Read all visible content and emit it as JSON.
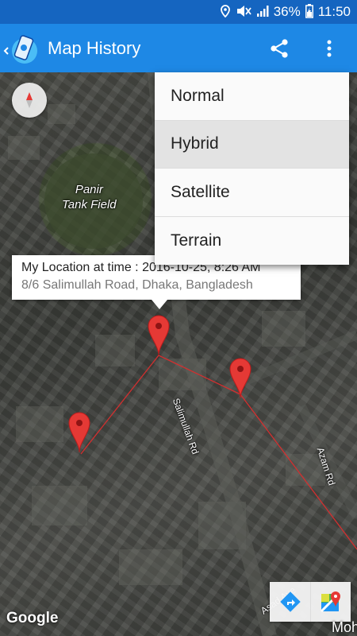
{
  "status_bar": {
    "battery": "36%",
    "time": "11:50"
  },
  "app_bar": {
    "title": "Map History"
  },
  "map": {
    "place_label": "Panir\nTank Field",
    "roads": [
      {
        "label": "Salimullah Rd"
      },
      {
        "label": "Azam Rd"
      },
      {
        "label": "Asad Ave"
      }
    ],
    "corner_text": "Moh",
    "google_logo": "Google",
    "info_window": {
      "title": "My Location at time : 2016-10-25,  8:26 AM",
      "address": "8/6 Salimullah Road, Dhaka, Bangladesh"
    },
    "path_color": "#d32f2f",
    "pin_color": "#e53935"
  },
  "menu": {
    "items": [
      {
        "label": "Normal"
      },
      {
        "label": "Hybrid"
      },
      {
        "label": "Satellite"
      },
      {
        "label": "Terrain"
      }
    ],
    "selected": "Hybrid"
  }
}
